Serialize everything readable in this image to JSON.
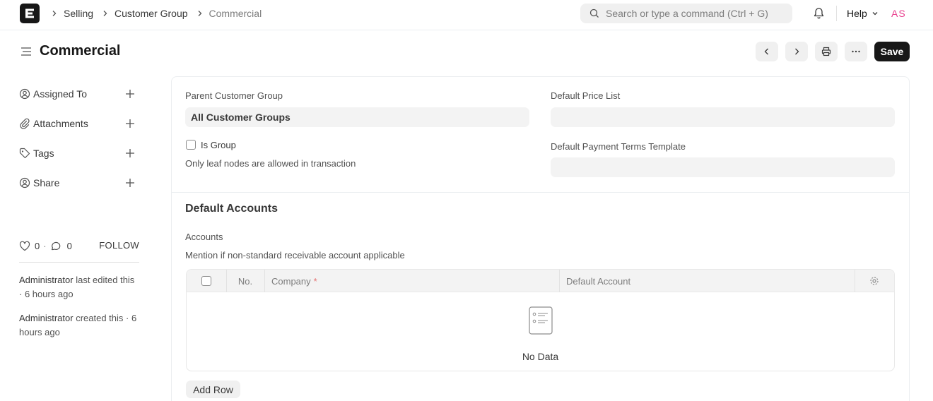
{
  "navbar": {
    "breadcrumbs": [
      "Selling",
      "Customer Group",
      "Commercial"
    ],
    "search_placeholder": "Search or type a command (Ctrl + G)",
    "help_label": "Help",
    "avatar_initials": "AS"
  },
  "page": {
    "title": "Commercial",
    "save_label": "Save"
  },
  "sidebar": {
    "items": [
      {
        "label": "Assigned To",
        "icon": "assign-user-icon"
      },
      {
        "label": "Attachments",
        "icon": "paperclip-icon"
      },
      {
        "label": "Tags",
        "icon": "tag-icon"
      },
      {
        "label": "Share",
        "icon": "share-user-icon"
      }
    ],
    "likes": "0",
    "comments": "0",
    "follow_label": "FOLLOW",
    "activity": [
      {
        "user": "Administrator",
        "text": "last edited this · 6 hours ago"
      },
      {
        "user": "Administrator",
        "text": "created this · 6 hours ago"
      }
    ]
  },
  "form": {
    "parent_group_label": "Parent Customer Group",
    "parent_group_value": "All Customer Groups",
    "is_group_label": "Is Group",
    "is_group_checked": false,
    "is_group_help": "Only leaf nodes are allowed in transaction",
    "price_list_label": "Default Price List",
    "price_list_value": "",
    "payment_terms_label": "Default Payment Terms Template",
    "payment_terms_value": "",
    "section_title": "Default Accounts",
    "accounts_label": "Accounts",
    "accounts_help": "Mention if non-standard receivable account applicable",
    "grid": {
      "columns": [
        "No.",
        "Company",
        "Default Account"
      ],
      "required_marker": "*",
      "rows": [],
      "empty_text": "No Data"
    },
    "add_row_label": "Add Row"
  },
  "colors": {
    "accent_dark": "#171717",
    "avatar": "#e93f8e",
    "required": "#e57373"
  }
}
